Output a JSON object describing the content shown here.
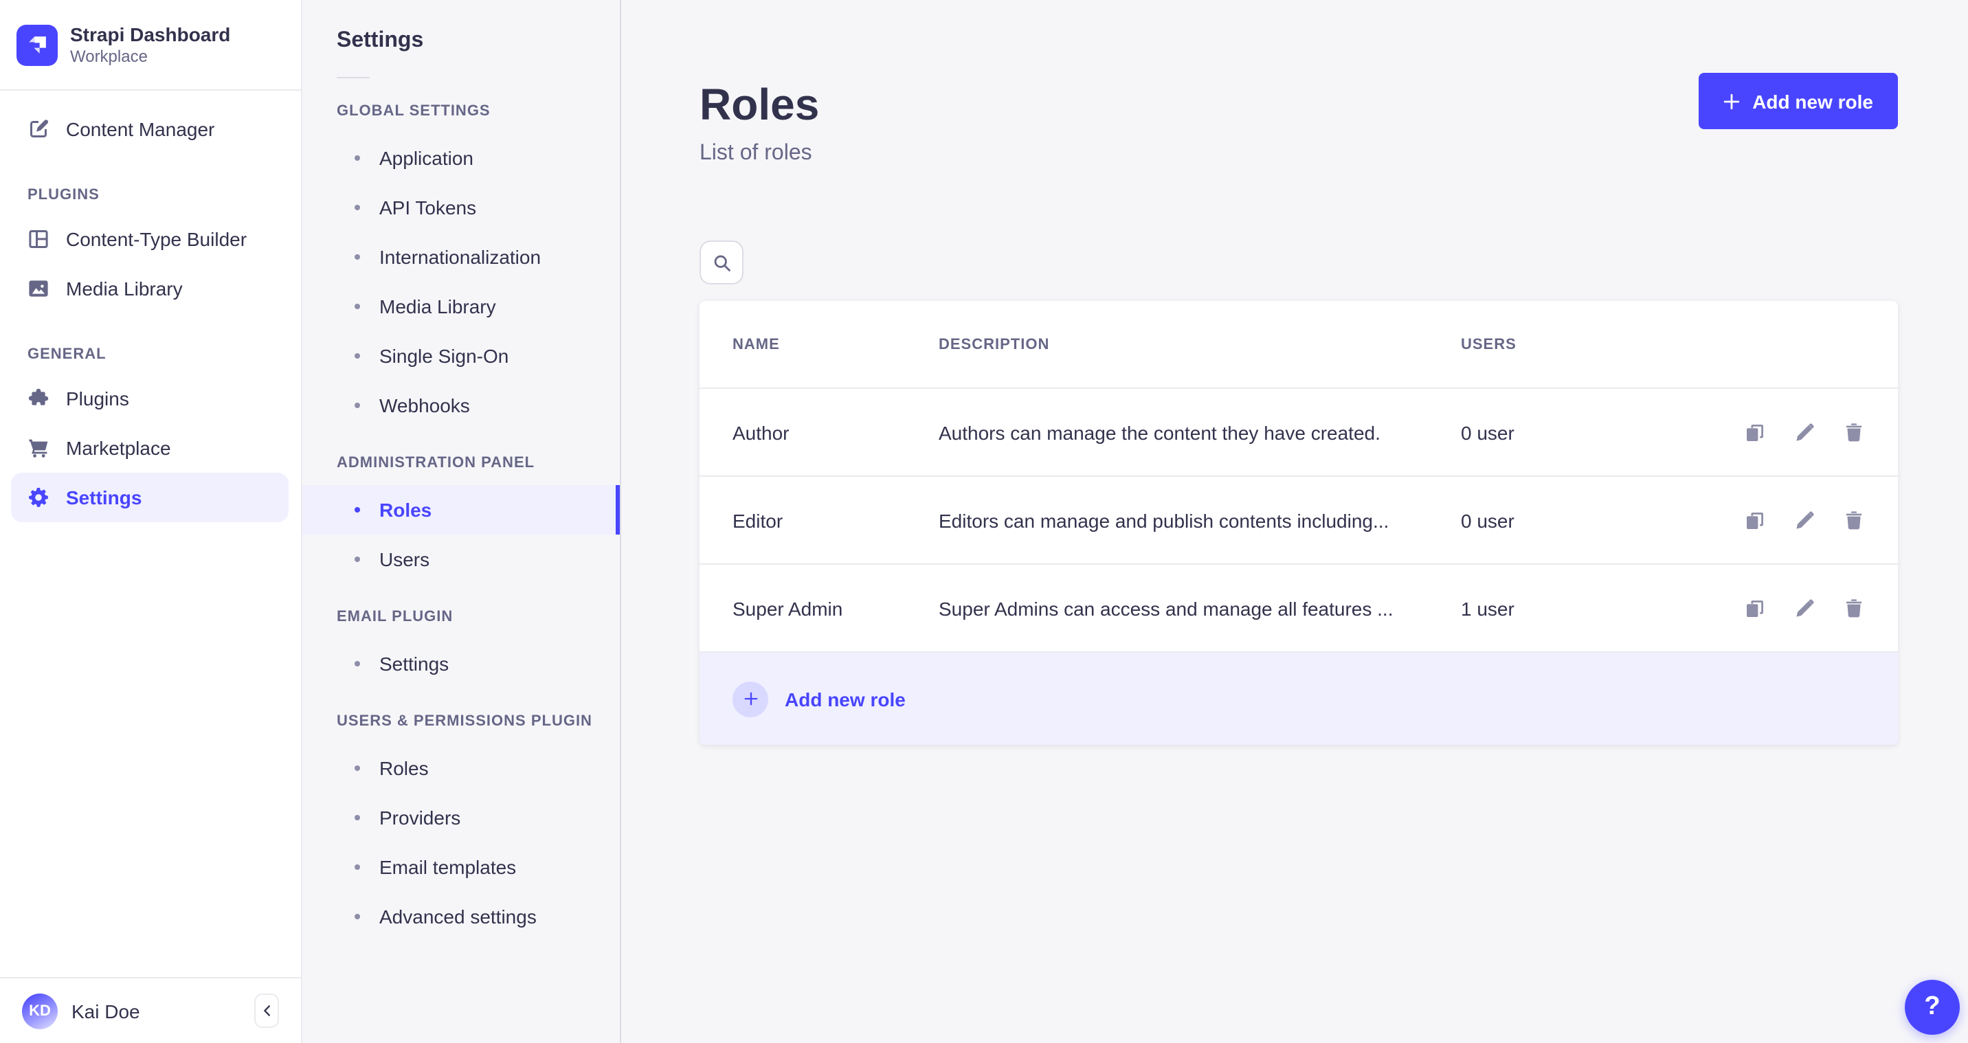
{
  "brand": {
    "title": "Strapi Dashboard",
    "subtitle": "Workplace"
  },
  "sidebar": {
    "top_item": {
      "label": "Content Manager",
      "icon": "feather-icon"
    },
    "sections": [
      {
        "label": "PLUGINS",
        "items": [
          {
            "label": "Content-Type Builder",
            "icon": "layout-icon",
            "active": false
          },
          {
            "label": "Media Library",
            "icon": "image-icon",
            "active": false
          }
        ]
      },
      {
        "label": "GENERAL",
        "items": [
          {
            "label": "Plugins",
            "icon": "puzzle-icon",
            "active": false
          },
          {
            "label": "Marketplace",
            "icon": "cart-icon",
            "active": false
          },
          {
            "label": "Settings",
            "icon": "gear-icon",
            "active": true
          }
        ]
      }
    ],
    "user": {
      "initials": "KD",
      "name": "Kai Doe"
    }
  },
  "subnav": {
    "title": "Settings",
    "sections": [
      {
        "label": "GLOBAL SETTINGS",
        "items": [
          {
            "label": "Application",
            "active": false
          },
          {
            "label": "API Tokens",
            "active": false
          },
          {
            "label": "Internationalization",
            "active": false
          },
          {
            "label": "Media Library",
            "active": false
          },
          {
            "label": "Single Sign-On",
            "active": false
          },
          {
            "label": "Webhooks",
            "active": false
          }
        ]
      },
      {
        "label": "ADMINISTRATION PANEL",
        "items": [
          {
            "label": "Roles",
            "active": true
          },
          {
            "label": "Users",
            "active": false
          }
        ]
      },
      {
        "label": "EMAIL PLUGIN",
        "items": [
          {
            "label": "Settings",
            "active": false
          }
        ]
      },
      {
        "label": "USERS & PERMISSIONS PLUGIN",
        "items": [
          {
            "label": "Roles",
            "active": false
          },
          {
            "label": "Providers",
            "active": false
          },
          {
            "label": "Email templates",
            "active": false
          },
          {
            "label": "Advanced settings",
            "active": false
          }
        ]
      }
    ]
  },
  "page": {
    "title": "Roles",
    "subtitle": "List of roles",
    "add_button_label": "Add new role",
    "help_label": "?"
  },
  "table": {
    "headers": {
      "name": "NAME",
      "description": "DESCRIPTION",
      "users": "USERS"
    },
    "rows": [
      {
        "name": "Author",
        "description": "Authors can manage the content they have created.",
        "users": "0 user"
      },
      {
        "name": "Editor",
        "description": "Editors can manage and publish contents including...",
        "users": "0 user"
      },
      {
        "name": "Super Admin",
        "description": "Super Admins can access and manage all features ...",
        "users": "1 user"
      }
    ],
    "footer_action_label": "Add new role"
  },
  "colors": {
    "primary": "#4945ff",
    "primary_light": "#f0f0ff",
    "text_dark": "#32324d",
    "text_gray": "#666687",
    "icon_gray": "#8e8ea9",
    "border": "#eaeaef",
    "background": "#f6f6f9"
  }
}
